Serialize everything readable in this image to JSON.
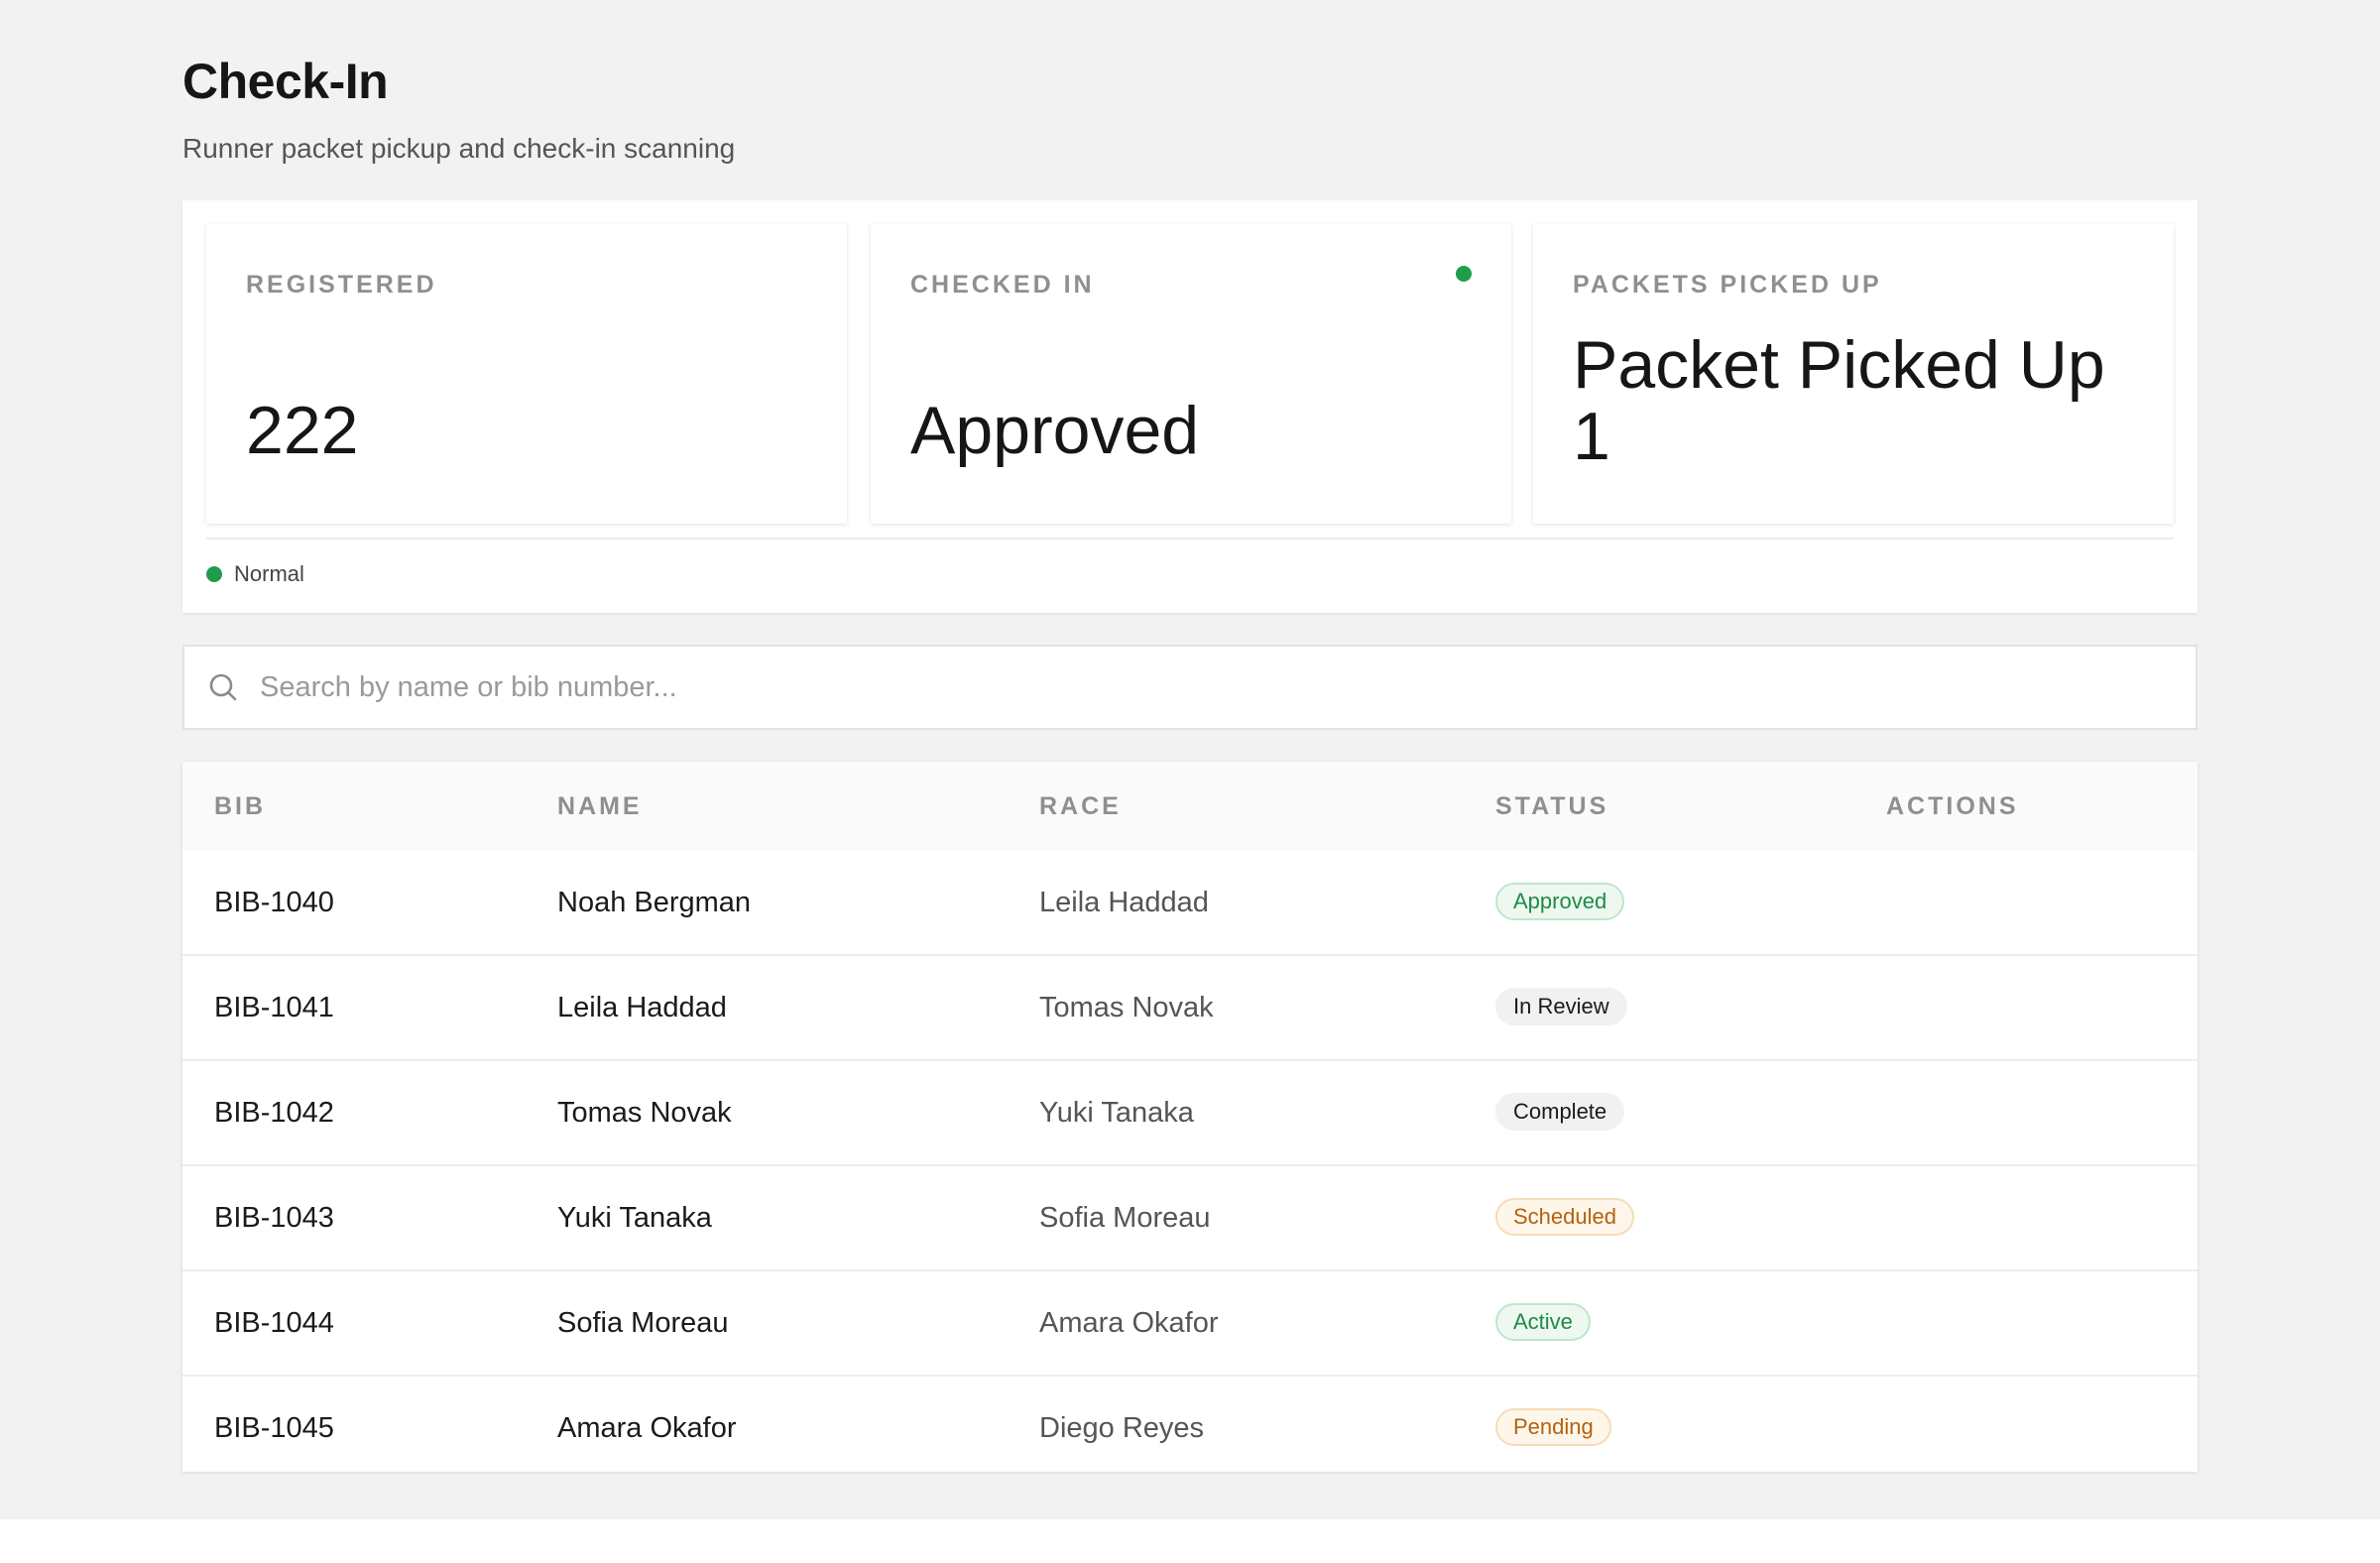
{
  "header": {
    "title": "Check-In",
    "subtitle": "Runner packet pickup and check-in scanning"
  },
  "stats": [
    {
      "label": "REGISTERED",
      "value": "222"
    },
    {
      "label": "CHECKED IN",
      "value": "Approved",
      "indicator_color": "#1f9d4c"
    },
    {
      "label": "PACKETS PICKED UP",
      "value": "Packet Picked Up 1"
    }
  ],
  "system_status": {
    "text": "Normal",
    "color": "#1f9d4c"
  },
  "search": {
    "placeholder": "Search by name or bib number...",
    "value": ""
  },
  "table": {
    "columns": [
      "BIB",
      "NAME",
      "RACE",
      "STATUS",
      "ACTIONS"
    ],
    "rows": [
      {
        "bib": "BIB-1040",
        "name": "Noah Bergman",
        "race": "Leila Haddad",
        "status": "Approved",
        "status_tone": "green"
      },
      {
        "bib": "BIB-1041",
        "name": "Leila Haddad",
        "race": "Tomas Novak",
        "status": "In Review",
        "status_tone": "gray"
      },
      {
        "bib": "BIB-1042",
        "name": "Tomas Novak",
        "race": "Yuki Tanaka",
        "status": "Complete",
        "status_tone": "gray"
      },
      {
        "bib": "BIB-1043",
        "name": "Yuki Tanaka",
        "race": "Sofia Moreau",
        "status": "Scheduled",
        "status_tone": "orange"
      },
      {
        "bib": "BIB-1044",
        "name": "Sofia Moreau",
        "race": "Amara Okafor",
        "status": "Active",
        "status_tone": "green"
      },
      {
        "bib": "BIB-1045",
        "name": "Amara Okafor",
        "race": "Diego Reyes",
        "status": "Pending",
        "status_tone": "orange"
      }
    ]
  },
  "colors": {
    "success": "#1f9d4c",
    "page_background": "#f2f2f2"
  }
}
